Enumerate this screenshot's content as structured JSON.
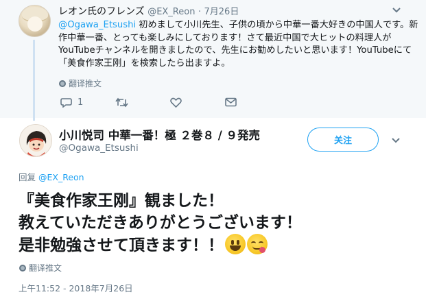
{
  "reply_tweet": {
    "display_name": "レオン氏のフレンズ",
    "handle": "@EX_Reon",
    "separator": "·",
    "date": "7月26日",
    "mention": "@Ogawa_Etsushi",
    "text": " 初めまして小川先生、子供の頃から中華一番大好きの中国人です。新作中華一番、とっても楽しみにしております！さて最近中国で大ヒットの料理人がYouTubeチャンネルを開きましたので、先生にお勧めしたいと思います！YouTubeにて「美食作家王刚」を検索したら出ますよ。",
    "translate_label": "翻译推文",
    "reply_count": "1"
  },
  "main_tweet": {
    "display_name": "小川悦司 中華一番！極 ２巻８ / ９発売",
    "handle": "@Ogawa_Etsushi",
    "follow_label": "关注",
    "reply_to_prefix": "回复",
    "reply_to_handle": "@EX_Reon",
    "text_lines": [
      "『美食作家王刚』観ました！",
      "教えていただきありがとうございます！",
      "是非勉強させて頂きます！！"
    ],
    "translate_label": "翻译推文",
    "timestamp": "上午11:52 - 2018年7月26日"
  },
  "icons": {
    "reply": "reply-icon",
    "retweet": "retweet-icon",
    "like": "heart-icon",
    "dm": "envelope-icon",
    "globe": "globe-icon",
    "caret": "chevron-down-icon"
  },
  "colors": {
    "accent": "#1da1f2",
    "muted": "#657786",
    "reply_background": "#f5f8fa",
    "thread_line": "#cfe1f2"
  }
}
